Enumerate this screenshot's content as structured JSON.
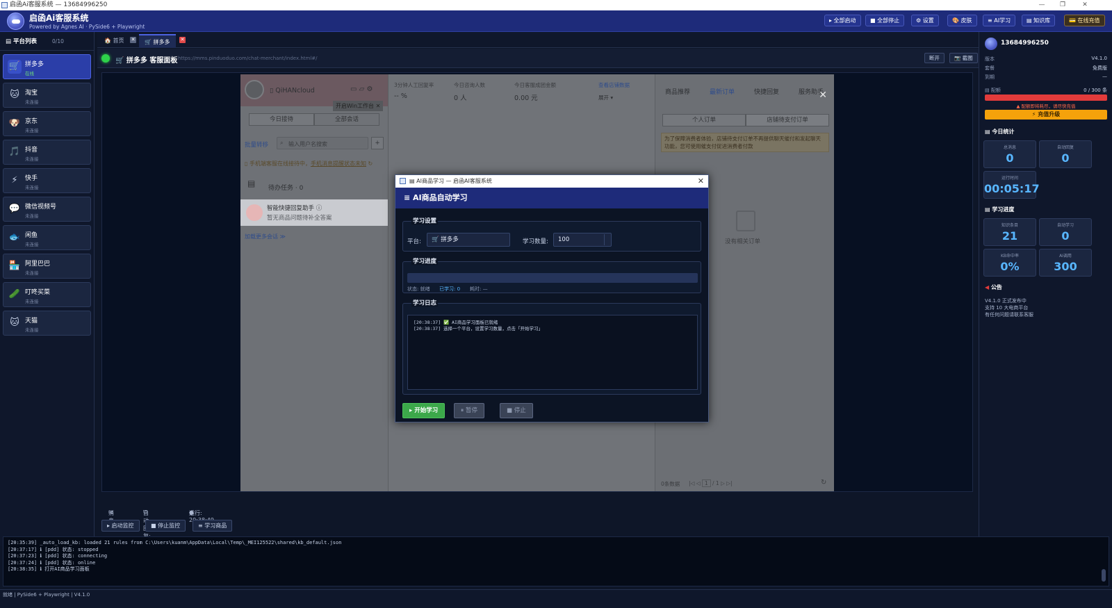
{
  "window": {
    "title": "启函Ai客服系统 — 13684996250"
  },
  "header": {
    "app_name": "启函Ai客服系统",
    "app_sub": "Powered by Agnes AI · PySide6 + Playwright",
    "buttons": [
      "▸ 全部启动",
      "■ 全部停止",
      "⚙ 设置",
      "🎨 皮肤",
      "≡ AI学习",
      "▤ 知识库",
      "💳 在线充值"
    ]
  },
  "left": {
    "title": "平台列表",
    "count": "0/10",
    "platforms": [
      {
        "name": "拼多多",
        "status": "在线",
        "icon": "🛒"
      },
      {
        "name": "淘宝",
        "status": "未连接",
        "icon": "🐱"
      },
      {
        "name": "京东",
        "status": "未连接",
        "icon": "🐶"
      },
      {
        "name": "抖音",
        "status": "未连接",
        "icon": "🎵"
      },
      {
        "name": "快手",
        "status": "未连接",
        "icon": "⚡"
      },
      {
        "name": "微信视频号",
        "status": "未连接",
        "icon": "💬"
      },
      {
        "name": "闲鱼",
        "status": "未连接",
        "icon": "🐟"
      },
      {
        "name": "阿里巴巴",
        "status": "未连接",
        "icon": "🏪"
      },
      {
        "name": "叮咚买菜",
        "status": "未连接",
        "icon": "🥒"
      },
      {
        "name": "天猫",
        "status": "未连接",
        "icon": "🐱"
      }
    ]
  },
  "tabs": [
    {
      "label": "🏠 首页"
    },
    {
      "label": "🛒 拼多多"
    }
  ],
  "panel": {
    "title": "🛒 拼多多 客服面板",
    "url": "https://mms.pinduoduo.com/chat-merchant/index.html#/",
    "disconnect": "断开",
    "screenshot": "📷 截图"
  },
  "page": {
    "shop_name": "QiHANcloud",
    "open_win": "开启Win工作台",
    "today_recv": "今日接待",
    "all_sessions": "全部会话",
    "batch_transfer": "批量转移",
    "search_ph": "输入用户名搜索",
    "notice_text": "手机端客服在线接待中，",
    "notice_link": "手机消息提醒状态未知",
    "pending": "待办任务 · 0",
    "assistant": "智能快捷回复助手",
    "assistant_sub": "暂无商品问题待补全答案",
    "load_more": "加载更多会话 ≫",
    "metric1_label": "3分钟人工回复率",
    "metric1_val": "-- %",
    "metric2_label": "今日咨询人数",
    "metric2_val": "0 人",
    "metric3_label": "今日客服成团金额",
    "metric3_val": "0.00 元",
    "view_store": "查看店铺数据",
    "expand": "展开 ▾",
    "rtabs": [
      "商品推荐",
      "最新订单",
      "快捷回复",
      "服务助手"
    ],
    "personal_order": "个人订单",
    "store_unpaid": "店铺待支付订单",
    "warn_text": "为了保障消费者体验，店铺待支付订单不再提供聊天催付和发起聊天功能，您可使用催支付促进消费者付款",
    "no_order": "没有相关订单",
    "data_count": "0条数据",
    "pager": "1",
    "pager_total": "/ 1"
  },
  "footer": {
    "msg": "消息: —",
    "auto": "自动回复: —",
    "run": "运行: 20:38:49",
    "btn_start": "▸ 启动监控",
    "btn_stop": "■ 停止监控",
    "btn_learn": "≡ 学习商品"
  },
  "dialog": {
    "win_title": "AI商品学习 — 启函AI客服系统",
    "head": "≡ AI商品自动学习",
    "settings_title": "学习设置",
    "platform_label": "平台:",
    "platform_value": "🛒 拼多多",
    "count_label": "学习数量:",
    "count_value": "100",
    "progress_title": "学习进度",
    "progress": 0,
    "status_text": "状态: 就绪",
    "learned_text": "已学习: 0",
    "time_text": "耗时: —",
    "log_title": "学习日志",
    "log_lines": [
      "[20:38:37] ✅ AI商品学习面板已就绪",
      "[20:38:37] 选择一个平台，设置学习数量，点击「开始学习」"
    ],
    "btn_start": "▸ 开始学习",
    "btn_pause": "⏸ 暂停",
    "btn_stop": "■ 停止"
  },
  "right": {
    "phone": "13684996250",
    "version_label": "版本",
    "version": "V4.1.0",
    "plan_label": "套餐",
    "plan": "免费版",
    "expire_label": "到期",
    "expire": "—",
    "quota_label": "▤ 配额",
    "quota": "0 / 300 条",
    "warn": "▲ 配额即将耗尽，请尽快充值",
    "charge": "⚡ 充值升级",
    "today_title": "今日统计",
    "today_stats": [
      {
        "label": "总消息",
        "value": "0"
      },
      {
        "label": "自动回复",
        "value": "0"
      },
      {
        "label": "运行时间",
        "value": "00:05:17"
      }
    ],
    "learn_title": "学习进度",
    "learn_stats": [
      {
        "label": "知识条目",
        "value": "21"
      },
      {
        "label": "自动学习",
        "value": "0"
      },
      {
        "label": "KB命中率",
        "value": "0%"
      },
      {
        "label": "AI调用",
        "value": "300"
      }
    ],
    "notice_title": "公告",
    "notice": [
      "V4.1.0 正式发布中",
      "支持 10 大电商平台",
      "有任何问题请联系客服"
    ]
  },
  "log": [
    "[20:35:39] _auto_load_kb: loaded 21 rules from C:\\Users\\kuanm\\AppData\\Local\\Temp\\_MEI125522\\shared\\kb_default.json",
    "[20:37:17] ℹ [pdd] 状态: stopped",
    "[20:37:23] ℹ [pdd] 状态: connecting",
    "[20:37:24] ℹ [pdd] 状态: online",
    "[20:38:35] ℹ 打开AI商品学习面板"
  ],
  "statusbar": "就绪 | PySide6 + Playwright | V4.1.0"
}
